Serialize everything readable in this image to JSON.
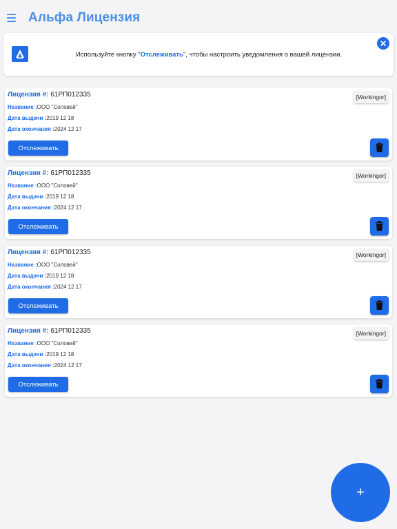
{
  "app": {
    "title": "Альфа Лицензия"
  },
  "notice": {
    "text_before": "Используйте кнопку  \"",
    "link_text": "Отслеживать",
    "text_after": "\", чтобы настроить уведомления о вашей лицензии."
  },
  "labels": {
    "license": "Лицензия #:",
    "name": "Название :",
    "issue_date": "Дата выдачи :",
    "end_date": "Дата окончания :",
    "track_button": "Отслеживать"
  },
  "licenses": [
    {
      "number": "61РП012335",
      "status": "[Workingor]",
      "name": "ООО \"Соловей\"",
      "issue_date": "2019 12 18",
      "end_date": "2024 12 17"
    },
    {
      "number": "61РП012335",
      "status": "[Workingor]",
      "name": "ООО \"Соловей\"",
      "issue_date": "2019 12 18",
      "end_date": "2024 12 17"
    },
    {
      "number": "61РП012335",
      "status": "[Workingor]",
      "name": "ООО \"Соловей\"",
      "issue_date": "2019 12 18",
      "end_date": "2024 12 17"
    },
    {
      "number": "61РП012335",
      "status": "[Workingor]",
      "name": "ООО \"Соловей\"",
      "issue_date": "2019 12 18",
      "end_date": "2024 12 17"
    }
  ],
  "fab": {
    "label": "+"
  },
  "colors": {
    "accent": "#1f6ce6",
    "title": "#4b8fe6",
    "background": "#f4f4f6"
  },
  "icons": {
    "menu": "menu-icon",
    "logo": "alfa-logo-icon",
    "close": "close-icon",
    "delete": "trash-icon",
    "add": "plus-icon"
  }
}
